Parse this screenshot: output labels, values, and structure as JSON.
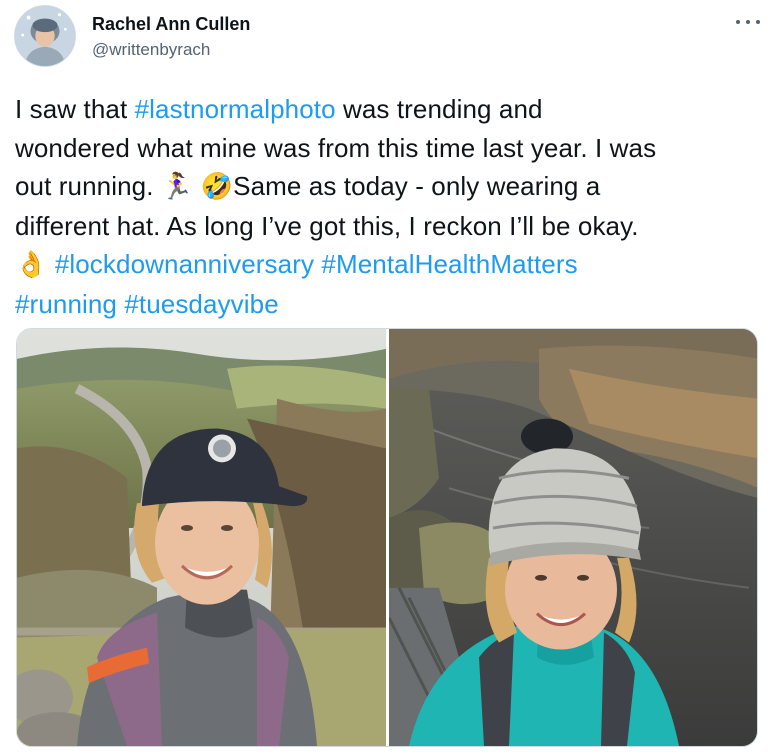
{
  "author": {
    "name": "Rachel Ann Cullen",
    "handle": "@writtenbyrach"
  },
  "tweet": {
    "line1_pre": "I saw that ",
    "line1_tag": "#lastnormalphoto",
    "line1_post": " was trending and",
    "line2": "wondered what mine was from this time last year. I was",
    "line3_pre": "out running. ",
    "line3_emoji1": "🏃‍♀️",
    "line3_emoji2": "🤣",
    "line3_post": "Same as today - only wearing a",
    "line4": "different hat. As long I’ve got this, I reckon I’ll be okay.",
    "line5_emoji": "👌",
    "hashtags_line5": [
      "#lockdownanniversary",
      "#MentalHealthMatters"
    ],
    "hashtags_line6": [
      "#running",
      "#tuesdayvibe"
    ]
  },
  "media": {
    "left_photo": "selfie-runner-cap-valley",
    "right_photo": "selfie-runner-bobble-hat-river"
  },
  "colors": {
    "link": "#1d9bf0",
    "text": "#0f1419",
    "secondary": "#536471"
  }
}
